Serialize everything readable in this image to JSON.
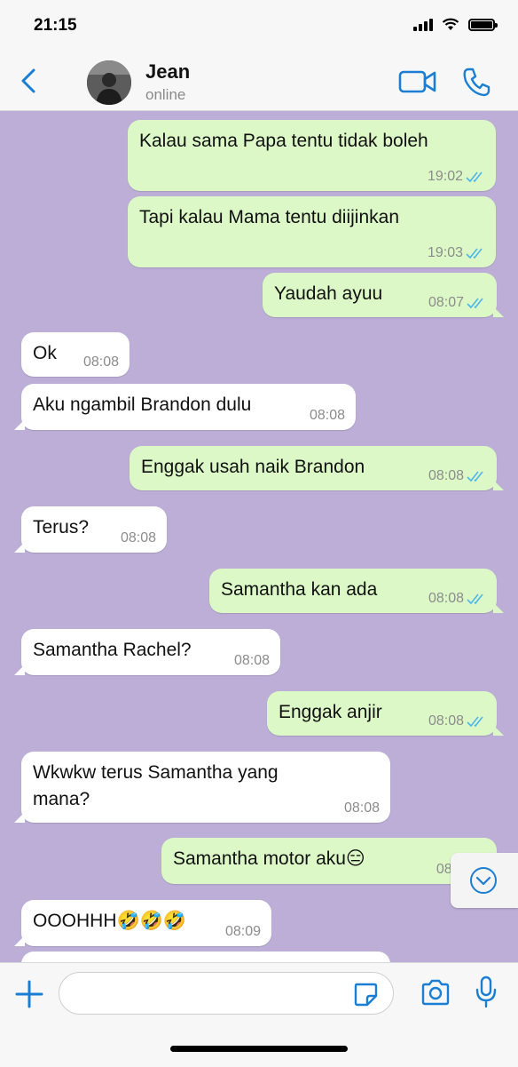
{
  "status_bar": {
    "time": "21:15"
  },
  "header": {
    "contact_name": "Jean",
    "contact_status": "online"
  },
  "messages": [
    {
      "dir": "out",
      "text": "Kalau sama Papa tentu tidak boleh",
      "time": "19:02",
      "read": true
    },
    {
      "dir": "out",
      "text": "Tapi kalau Mama tentu diijinkan",
      "time": "19:03",
      "read": true
    },
    {
      "dir": "out",
      "text": "Yaudah ayuu",
      "time": "08:07",
      "read": true
    },
    {
      "dir": "in",
      "text": "Ok",
      "time": "08:08"
    },
    {
      "dir": "in",
      "text": "Aku ngambil Brandon dulu",
      "time": "08:08"
    },
    {
      "dir": "out",
      "text": "Enggak usah naik Brandon",
      "time": "08:08",
      "read": true
    },
    {
      "dir": "in",
      "text": "Terus?",
      "time": "08:08"
    },
    {
      "dir": "out",
      "text": "Samantha kan ada",
      "time": "08:08",
      "read": true
    },
    {
      "dir": "in",
      "text": "Samantha Rachel?",
      "time": "08:08"
    },
    {
      "dir": "out",
      "text": "Enggak anjir",
      "time": "08:08",
      "read": true
    },
    {
      "dir": "in",
      "text_line1": "Wkwkw terus Samantha yang",
      "text_line2": "mana?",
      "time": "08:08"
    },
    {
      "dir": "out",
      "text": "Samantha motor aku😑",
      "time": "08:0",
      "read": true
    },
    {
      "dir": "in",
      "text": "OOOHHH🤣🤣🤣",
      "time": "08:09"
    }
  ],
  "colors": {
    "chat_background": "#bcaed6",
    "outgoing_bubble": "#dcf8c6",
    "incoming_bubble": "#ffffff",
    "accent": "#1a7fd4",
    "read_ticks": "#4fb6ec"
  },
  "icons": {
    "back": "chevron-left-icon",
    "video": "video-camera-icon",
    "call": "phone-icon",
    "attach": "plus-icon",
    "sticker": "sticker-icon",
    "camera": "camera-icon",
    "mic": "microphone-icon",
    "scroll": "chevron-down-circle-icon"
  }
}
